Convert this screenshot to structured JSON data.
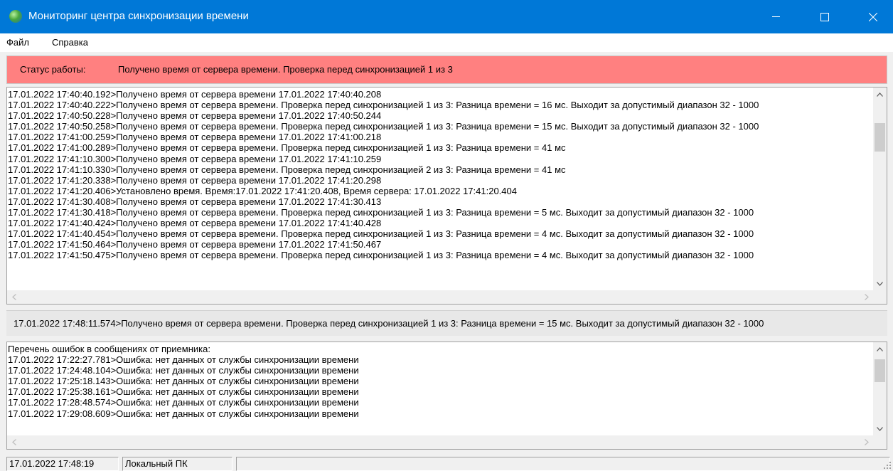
{
  "window": {
    "title": "Мониторинг центра синхронизации времени",
    "titlebar_color": "#0078d7"
  },
  "menu": {
    "items": [
      "Файл",
      "Справка"
    ]
  },
  "status": {
    "label": "Статус работы:",
    "text": "Получено время от сервера времени. Проверка перед синхронизацией 1 из 3",
    "color": "#ff8080"
  },
  "log": {
    "lines": [
      "17.01.2022 17:40:40.192>Получено время от сервера времени 17.01.2022 17:40:40.208",
      "17.01.2022 17:40:40.222>Получено время от сервера времени. Проверка перед синхронизацией 1 из 3: Разница времени = 16 мс. Выходит за допустимый диапазон 32 - 1000",
      "17.01.2022 17:40:50.228>Получено время от сервера времени 17.01.2022 17:40:50.244",
      "17.01.2022 17:40:50.258>Получено время от сервера времени. Проверка перед синхронизацией 1 из 3: Разница времени = 15 мс. Выходит за допустимый диапазон 32 - 1000",
      "17.01.2022 17:41:00.259>Получено время от сервера времени 17.01.2022 17:41:00.218",
      "17.01.2022 17:41:00.289>Получено время от сервера времени. Проверка перед синхронизацией 1 из 3: Разница времени = 41 мс",
      "17.01.2022 17:41:10.300>Получено время от сервера времени 17.01.2022 17:41:10.259",
      "17.01.2022 17:41:10.330>Получено время от сервера времени. Проверка перед синхронизацией 2 из 3: Разница времени = 41 мс",
      "17.01.2022 17:41:20.338>Получено время от сервера времени 17.01.2022 17:41:20.298",
      "17.01.2022 17:41:20.406>Установлено время. Время:17.01.2022 17:41:20.408, Время сервера: 17.01.2022 17:41:20.404",
      "17.01.2022 17:41:30.408>Получено время от сервера времени 17.01.2022 17:41:30.413",
      "17.01.2022 17:41:30.418>Получено время от сервера времени. Проверка перед синхронизацией 1 из 3: Разница времени = 5 мс. Выходит за допустимый диапазон 32 - 1000",
      "17.01.2022 17:41:40.424>Получено время от сервера времени 17.01.2022 17:41:40.428",
      "17.01.2022 17:41:40.454>Получено время от сервера времени. Проверка перед синхронизацией 1 из 3: Разница времени = 4 мс. Выходит за допустимый диапазон 32 - 1000",
      "17.01.2022 17:41:50.464>Получено время от сервера времени 17.01.2022 17:41:50.467",
      "17.01.2022 17:41:50.475>Получено время от сервера времени. Проверка перед синхронизацией 1 из 3: Разница времени = 4 мс. Выходит за допустимый диапазон 32 - 1000"
    ]
  },
  "last_message": "17.01.2022 17:48:11.574>Получено время от сервера времени. Проверка перед синхронизацией 1 из 3: Разница времени = 15 мс. Выходит за допустимый диапазон 32 - 1000",
  "errors": {
    "lines": [
      "Перечень ошибок в сообщениях от приемника:",
      "17.01.2022 17:22:27.781>Ошибка: нет данных от службы синхронизации времени",
      "17.01.2022 17:24:48.104>Ошибка: нет данных от службы синхронизации времени",
      "17.01.2022 17:25:18.143>Ошибка: нет данных от службы синхронизации времени",
      "17.01.2022 17:25:38.161>Ошибка: нет данных от службы синхронизации времени",
      "17.01.2022 17:28:48.574>Ошибка: нет данных от службы синхронизации времени",
      "17.01.2022 17:29:08.609>Ошибка: нет данных от службы синхронизации времени"
    ]
  },
  "statusbar": {
    "datetime": "17.01.2022 17:48:19",
    "mode": "Локальный ПК"
  }
}
